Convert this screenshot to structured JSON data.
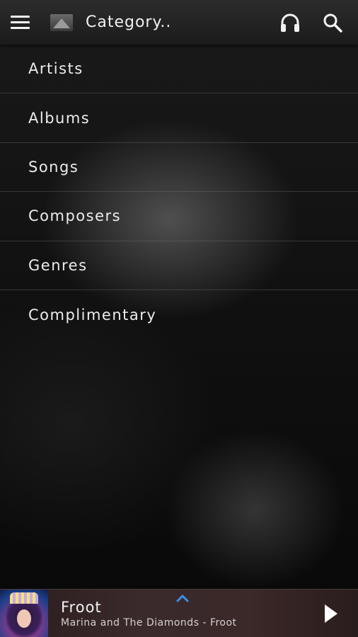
{
  "header": {
    "menu_icon": "hamburger-menu-icon",
    "logo_icon": "app-logo-icon",
    "title": "Category..",
    "headphones_icon": "headphones-icon",
    "search_icon": "search-icon"
  },
  "categories": [
    {
      "label": "Artists"
    },
    {
      "label": "Albums"
    },
    {
      "label": "Songs"
    },
    {
      "label": "Composers"
    },
    {
      "label": "Genres"
    },
    {
      "label": "Complimentary"
    }
  ],
  "now_playing": {
    "title": "Froot",
    "subtitle": "Marina and The Diamonds - Froot",
    "expand_icon": "chevron-up-icon",
    "play_icon": "play-icon",
    "accent_color": "#3b8fe8"
  }
}
